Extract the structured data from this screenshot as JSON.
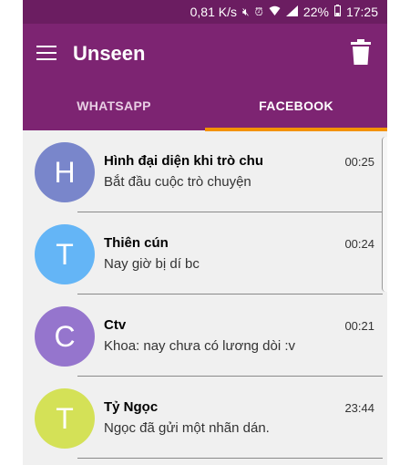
{
  "status": {
    "speed": "0,81 K/s",
    "icons": [
      "mute-icon",
      "alarm-icon",
      "wifi-icon",
      "signal-icon",
      "battery-icon"
    ],
    "battery": "22%",
    "time": "17:25"
  },
  "appbar": {
    "title": "Unseen",
    "color": "#7d2472"
  },
  "tabs": [
    {
      "label": "WHATSAPP",
      "active": false
    },
    {
      "label": "FACEBOOK",
      "active": true
    }
  ],
  "accent": "#f39200",
  "conversations": [
    {
      "initial": "H",
      "name": "Hình đại diện khi trò chu",
      "message": "Bắt đầu cuộc trò chuyện",
      "time": "00:25",
      "color": "#7986cb"
    },
    {
      "initial": "T",
      "name": "Thiên cún",
      "message": "Nay giờ bị dí bc",
      "time": "00:24",
      "color": "#64b5f6"
    },
    {
      "initial": "C",
      "name": "Ctv",
      "message": "Khoa: nay chưa có lương dòi :v",
      "time": "00:21",
      "color": "#9575cd"
    },
    {
      "initial": "T",
      "name": "Tỷ Ngọc",
      "message": "Ngọc đã gửi một nhãn dán.",
      "time": "23:44",
      "color": "#d4e157"
    }
  ]
}
